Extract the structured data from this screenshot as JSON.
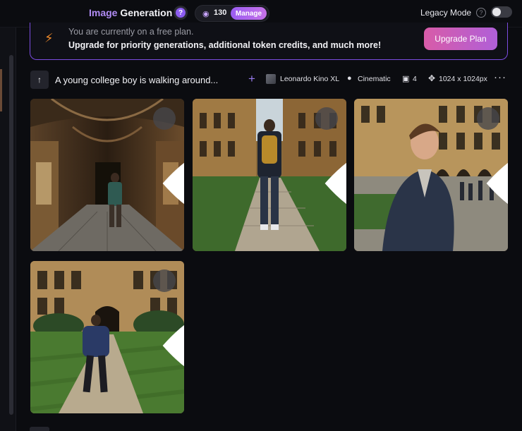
{
  "header": {
    "title_word1": "Image",
    "title_word2": "Generation",
    "help_label": "?",
    "token_count": "130",
    "manage_label": "Manage",
    "legacy_mode_label": "Legacy Mode",
    "legacy_mode_help": "?",
    "legacy_mode_enabled": false
  },
  "banner": {
    "line1": "You are currently on a free plan.",
    "line2": "Upgrade for priority generations, additional token credits, and much more!",
    "button_label": "Upgrade Plan"
  },
  "generation": {
    "prompt": "A young college boy is walking around...",
    "model": "Leonardo Kino XL",
    "style": "Cinematic",
    "image_count": "4",
    "dimensions": "1024 x 1024px"
  },
  "images": [
    {
      "scene": "cloister-corridor"
    },
    {
      "scene": "college-quad-walkway"
    },
    {
      "scene": "portrait-in-courtyard"
    },
    {
      "scene": "lawn-path-to-gate"
    }
  ],
  "colors": {
    "accent_purple": "#9a5cf2",
    "upgrade_gradient_start": "#d85ca8",
    "upgrade_gradient_end": "#b05fd8",
    "bolt_orange": "#f08a2a"
  }
}
